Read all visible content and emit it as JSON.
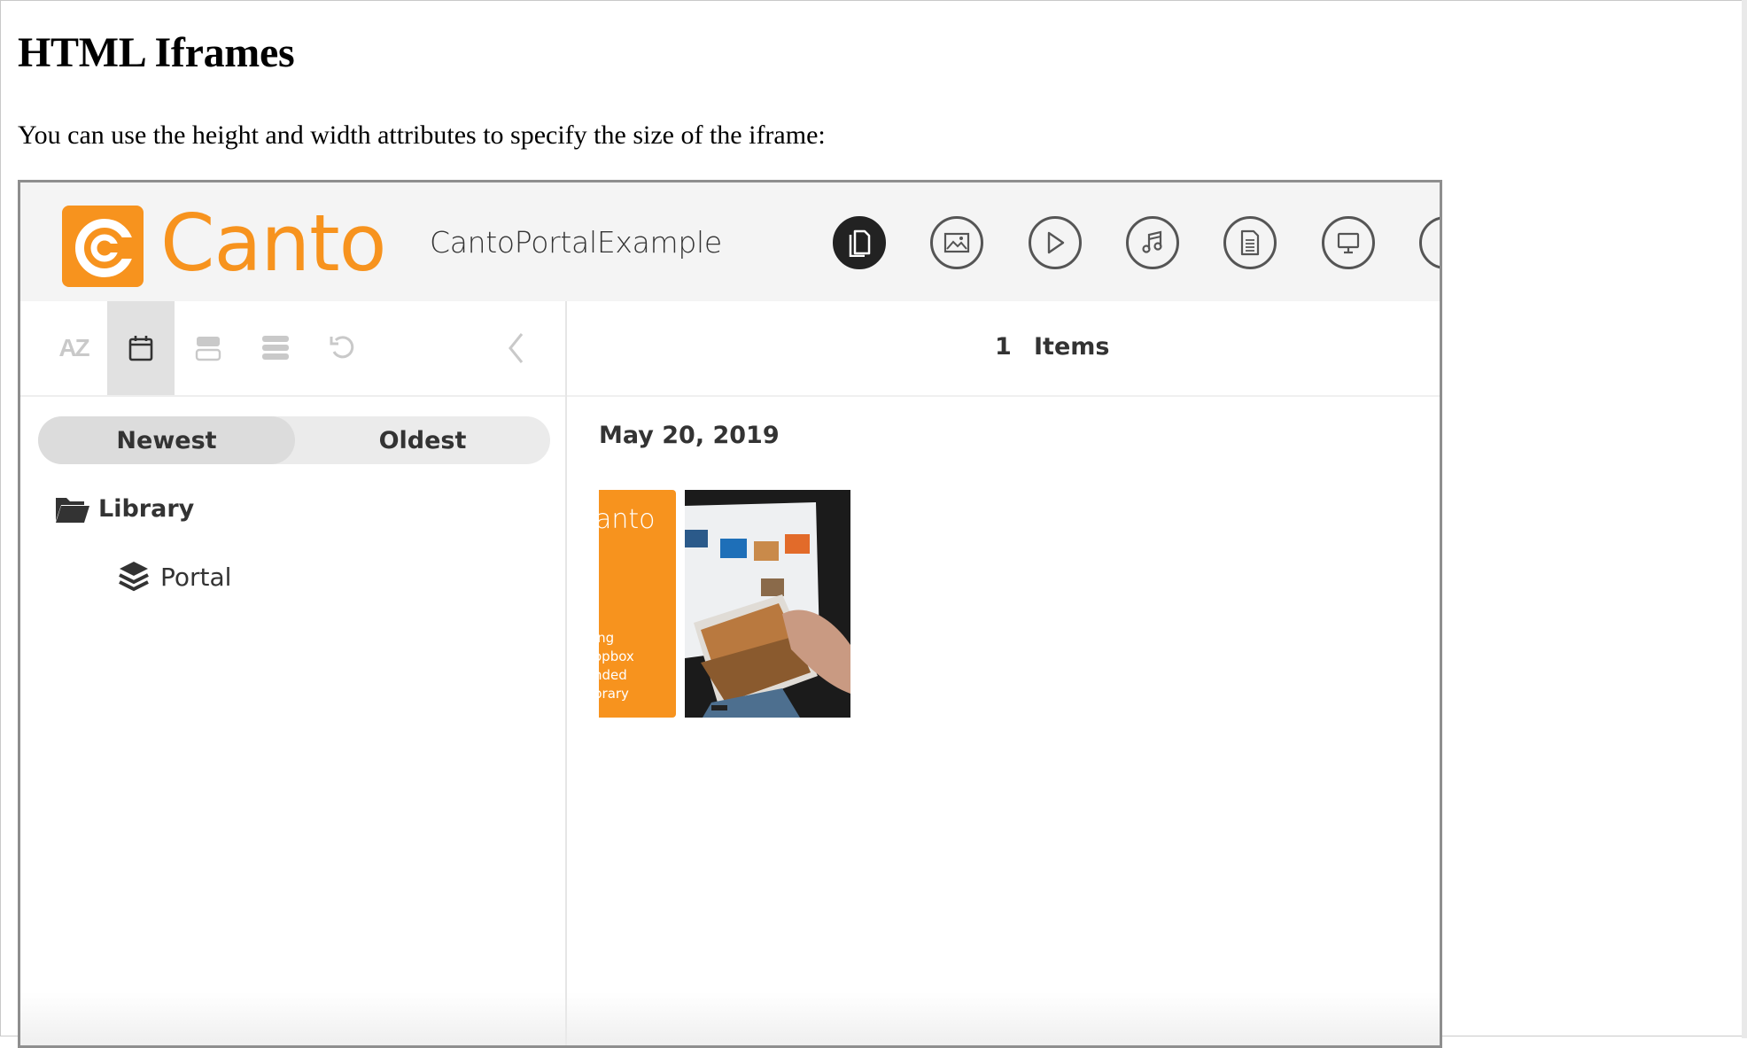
{
  "page": {
    "heading": "HTML Iframes",
    "intro": "You can use the height and width attributes to specify the size of the iframe:"
  },
  "portal": {
    "brand": "Canto",
    "name": "CantoPortalExample",
    "brand_color": "#f7931e",
    "filter_buttons": [
      {
        "icon": "document-icon",
        "active": true
      },
      {
        "icon": "image-icon",
        "active": false
      },
      {
        "icon": "play-icon",
        "active": false
      },
      {
        "icon": "music-icon",
        "active": false
      },
      {
        "icon": "text-document-icon",
        "active": false
      },
      {
        "icon": "presentation-icon",
        "active": false
      }
    ],
    "toolbar": {
      "az_label": "AZ",
      "tools": [
        "sort-az-icon",
        "calendar-icon",
        "card-view-icon",
        "list-view-icon",
        "reset-icon",
        "collapse-left-icon"
      ]
    },
    "sort": {
      "newest": "Newest",
      "oldest": "Oldest",
      "selected": "Newest"
    },
    "tree": {
      "library": "Library",
      "portal": "Portal"
    },
    "main": {
      "count": "1",
      "count_label": "Items",
      "date": "May 20, 2019",
      "thumb_logo": "anto",
      "thumb_lines": [
        "ing",
        "opbox",
        "nded",
        "brary"
      ]
    }
  }
}
